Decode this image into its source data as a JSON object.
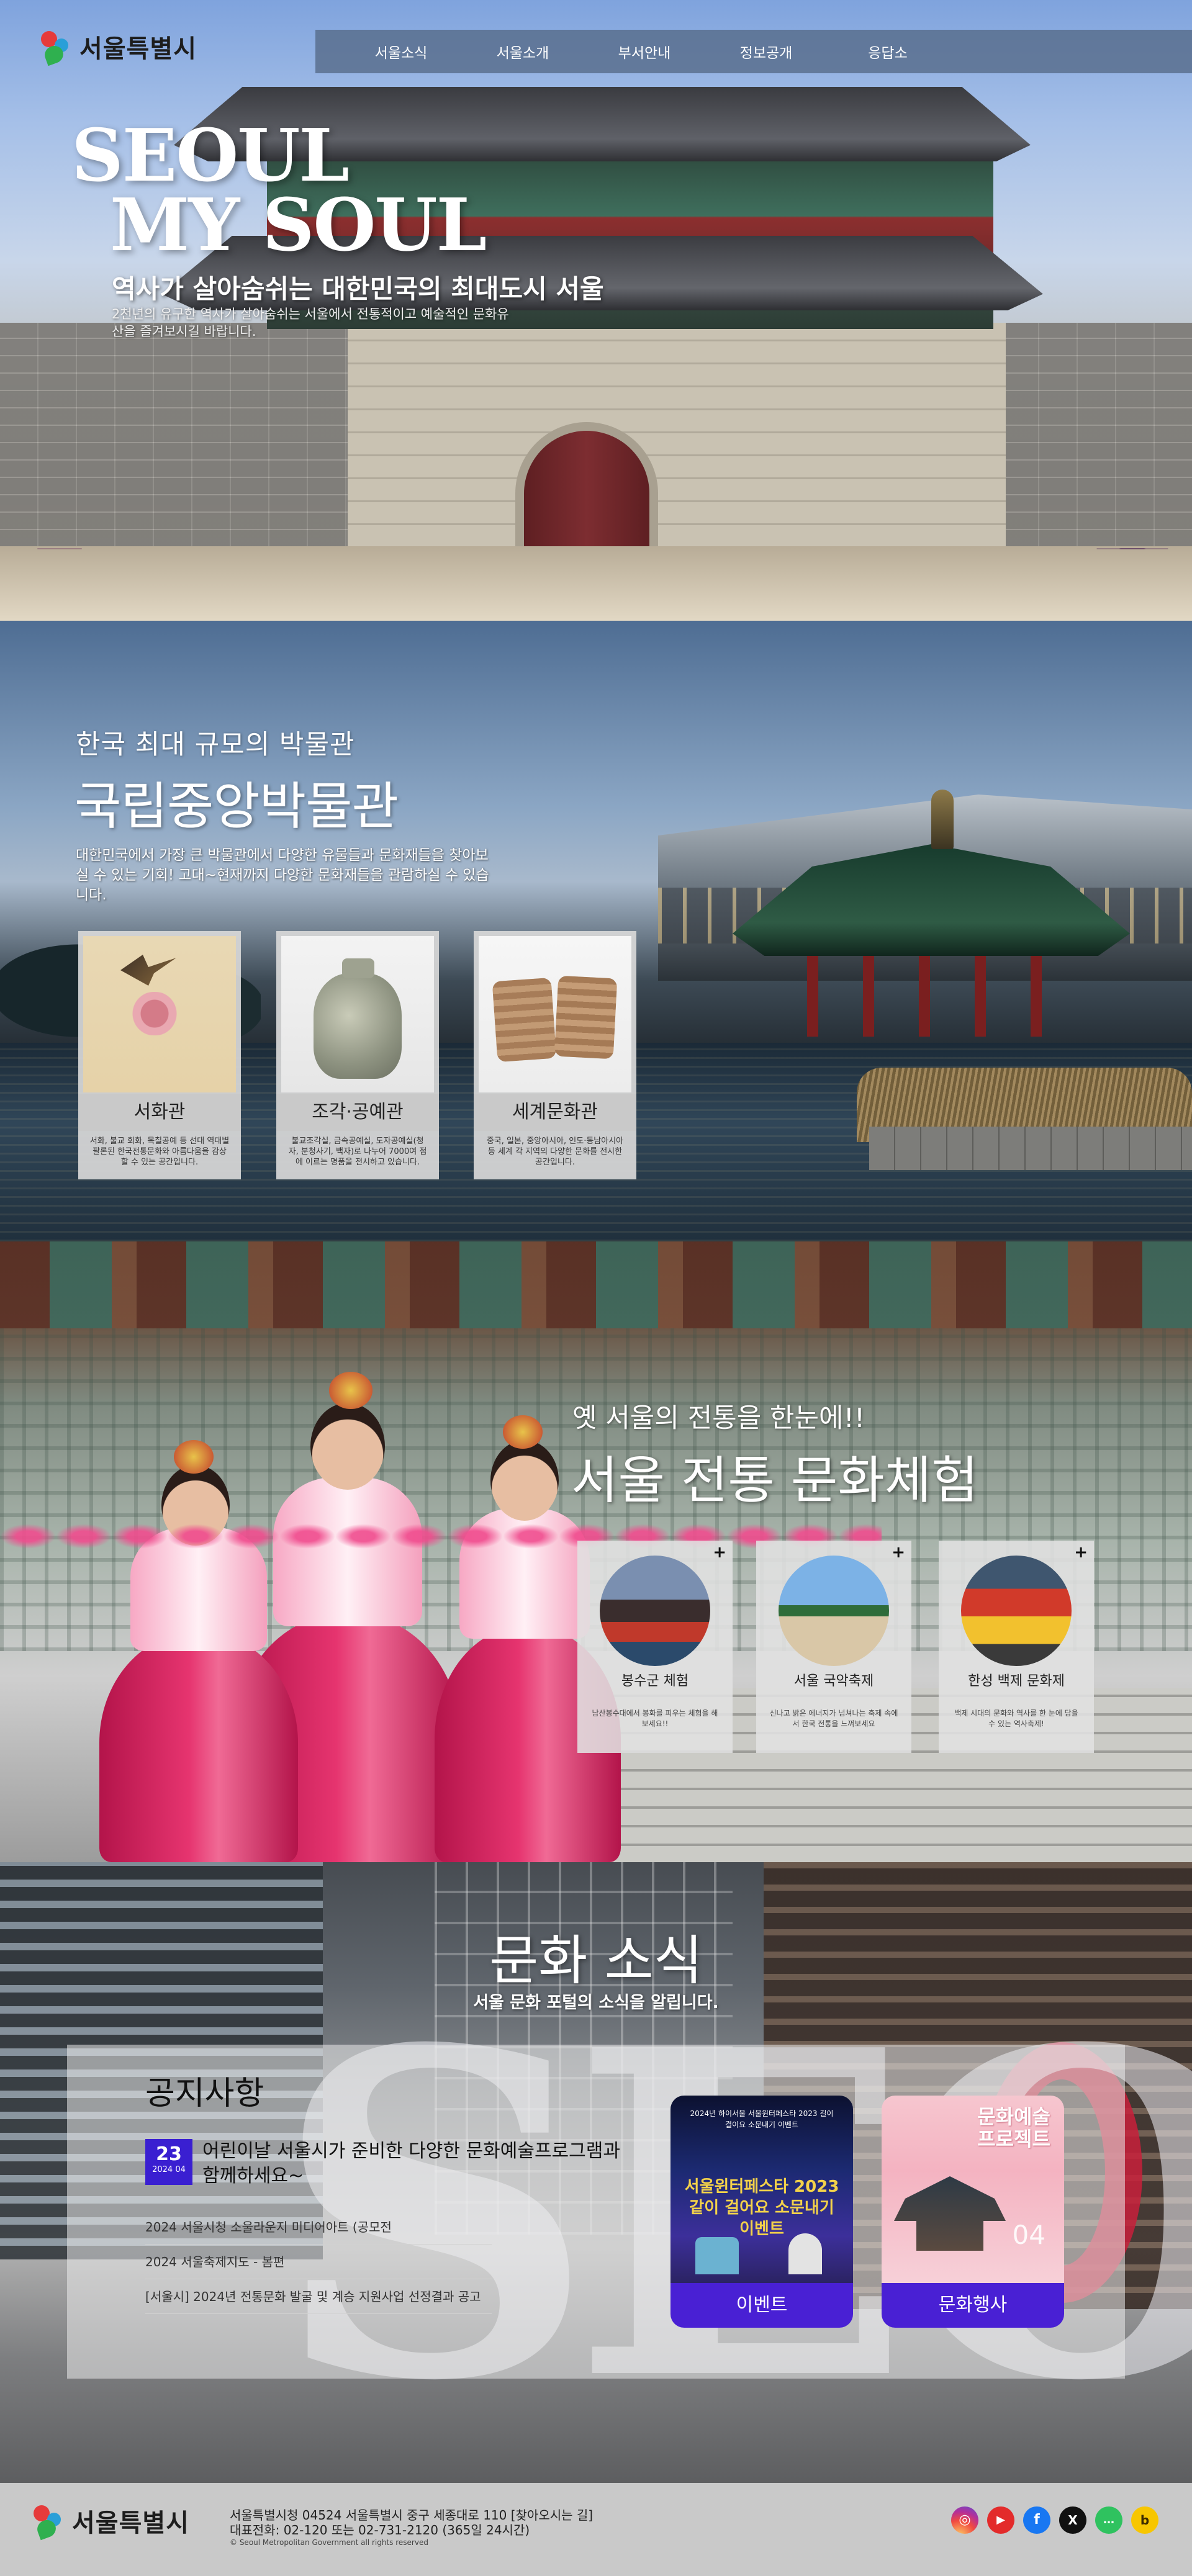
{
  "header": {
    "logo_text": "서울특별시",
    "nav": [
      "서울소식",
      "서울소개",
      "부서안내",
      "정보공개",
      "응답소"
    ]
  },
  "hero": {
    "title_line1": "SEOUL",
    "title_line2": "MY SOUL",
    "subtitle": "역사가 살아숨쉬는 대한민국의 최대도시 서울",
    "description": "2천년의 유구한 역사가 살아숨쉬는 서울에서 전통적이고 예술적인 문화유산을 즐겨보시길 바랍니다."
  },
  "museum": {
    "kicker": "한국 최대 규모의 박물관",
    "title": "국립중앙박물관",
    "description": "대한민국에서 가장 큰 박물관에서 다양한 유물들과 문화재들을 찾아보실 수 있는 기회! 고대~현재까지 다양한 문화재들을 관람하실 수 있습니다.",
    "cards": [
      {
        "name": "서화관",
        "desc": "서화, 불교 회화, 목칠공예 등 선대 역대별 팔론된 한국전통문화와 아름다움을 감상할 수 있는 공간입니다.",
        "icon": "painting-image"
      },
      {
        "name": "조각·공예관",
        "desc": "불교조각실, 금속공예실, 도자공예실(청자, 분청사기, 백자)로 나누어 7000여 점에 이르는 명품을 전시하고 있습니다.",
        "icon": "vase-image"
      },
      {
        "name": "세계문화관",
        "desc": "중국, 일본, 중앙아시아, 인도·동남아시아 등 세계 각 지역의 다양한 문화를 전시한 공간입니다.",
        "icon": "tablet-image"
      }
    ]
  },
  "traditional": {
    "kicker": "옛 서울의 전통을 한눈에!!",
    "title": "서울 전통 문화체험",
    "plus": "+",
    "cards": [
      {
        "name": "봉수군 체험",
        "desc": "남산봉수대에서 봉화를 피우는 체험을 해보세요!!",
        "icon": "guard-photo"
      },
      {
        "name": "서울 국악축제",
        "desc": "신나고 밝은 에너지가 넘쳐나는 축제 속에서 한국 전통을 느껴보세요",
        "icon": "gugak-photo"
      },
      {
        "name": "한성 백제 문화제",
        "desc": "백제 시대의 문화와 역사를 한 눈에 담을 수 있는 역사축제!",
        "icon": "baekje-photo"
      }
    ]
  },
  "news": {
    "title": "문화 소식",
    "subtitle": "서울 문화 포털의 소식을 알립니다.",
    "notice_heading": "공지사항",
    "featured": {
      "day": "23",
      "year_month": "2024 04",
      "text": "어린이날 서울시가 준비한 다양한 문화예술프로그램과 함께하세요~"
    },
    "items": [
      "2024 서울시청 소울라운지 미디어아트 (공모전",
      "2024 서울축제지도 - 봄편",
      "[서울시] 2024년 전통문화 발굴 및 계승 지원사업 선정결과 공고"
    ],
    "cards": [
      {
        "label": "이벤트",
        "img_top": "2024년 하이서울 서울윈터페스타 2023 길이 결이요 소문내기 이벤트",
        "img_main": "서울윈터페스타 2023 같이 걸어요 소문내기 이벤트"
      },
      {
        "label": "문화행사",
        "img_top": "문화예술 프로젝트",
        "img_num": "04"
      }
    ]
  },
  "footer": {
    "logo_text": "서울특별시",
    "address": "서울특별시청 04524 서울특별시 중구 세종대로 110 [찾아오시는 길]",
    "phone": "대표전화: 02-120 또는 02-731-2120 (365일 24시간)",
    "copyright": "© Seoul Metropolitan Government all rights reserved",
    "social": [
      {
        "name": "instagram-icon",
        "glyph": "◎"
      },
      {
        "name": "youtube-icon",
        "glyph": "▶"
      },
      {
        "name": "facebook-icon",
        "glyph": "f"
      },
      {
        "name": "x-icon",
        "glyph": "X"
      },
      {
        "name": "talk-icon",
        "glyph": "…"
      },
      {
        "name": "story-icon",
        "glyph": "b"
      }
    ]
  }
}
